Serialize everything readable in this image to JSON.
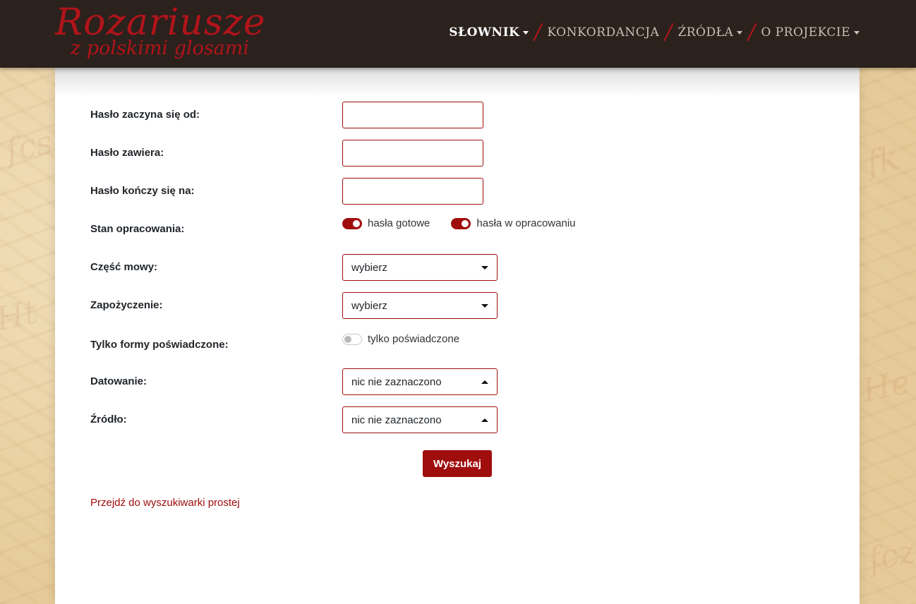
{
  "logo": {
    "line1": "Rozariusze",
    "line2": "z polskimi glosami"
  },
  "nav": {
    "items": [
      {
        "label": "SŁOWNIK",
        "has_dropdown": true,
        "active": true
      },
      {
        "label": "KONKORDANCJA",
        "has_dropdown": false,
        "active": false
      },
      {
        "label": "ŹRÓDŁA",
        "has_dropdown": true,
        "active": false
      },
      {
        "label": "O PROJEKCIE",
        "has_dropdown": true,
        "active": false
      }
    ],
    "separator": "/"
  },
  "form": {
    "starts_with": {
      "label": "Hasło zaczyna się od:",
      "value": ""
    },
    "contains": {
      "label": "Hasło zawiera:",
      "value": ""
    },
    "ends_with": {
      "label": "Hasło kończy się na:",
      "value": ""
    },
    "status": {
      "label": "Stan opracowania:",
      "toggles": [
        {
          "label": "hasła gotowe",
          "checked": true
        },
        {
          "label": "hasła w opracowaniu",
          "checked": true
        }
      ]
    },
    "part_of_speech": {
      "label": "Część mowy:",
      "value": "wybierz"
    },
    "borrowing": {
      "label": "Zapożyczenie:",
      "value": "wybierz"
    },
    "attested_only": {
      "label": "Tylko formy poświadczone:",
      "toggle": {
        "label": "tylko poświadczone",
        "checked": false
      }
    },
    "dating": {
      "label": "Datowanie:",
      "value": "nic nie zaznaczono"
    },
    "source": {
      "label": "Źródło:",
      "value": "nic nie zaznaczono"
    },
    "search_button": "Wyszukaj",
    "simple_search_link": "Przejdź do wyszukiwarki prostej"
  },
  "colors": {
    "accent": "#a00d0d",
    "header_bg": "#2b211d",
    "nav_inactive": "#c8bfb8"
  }
}
